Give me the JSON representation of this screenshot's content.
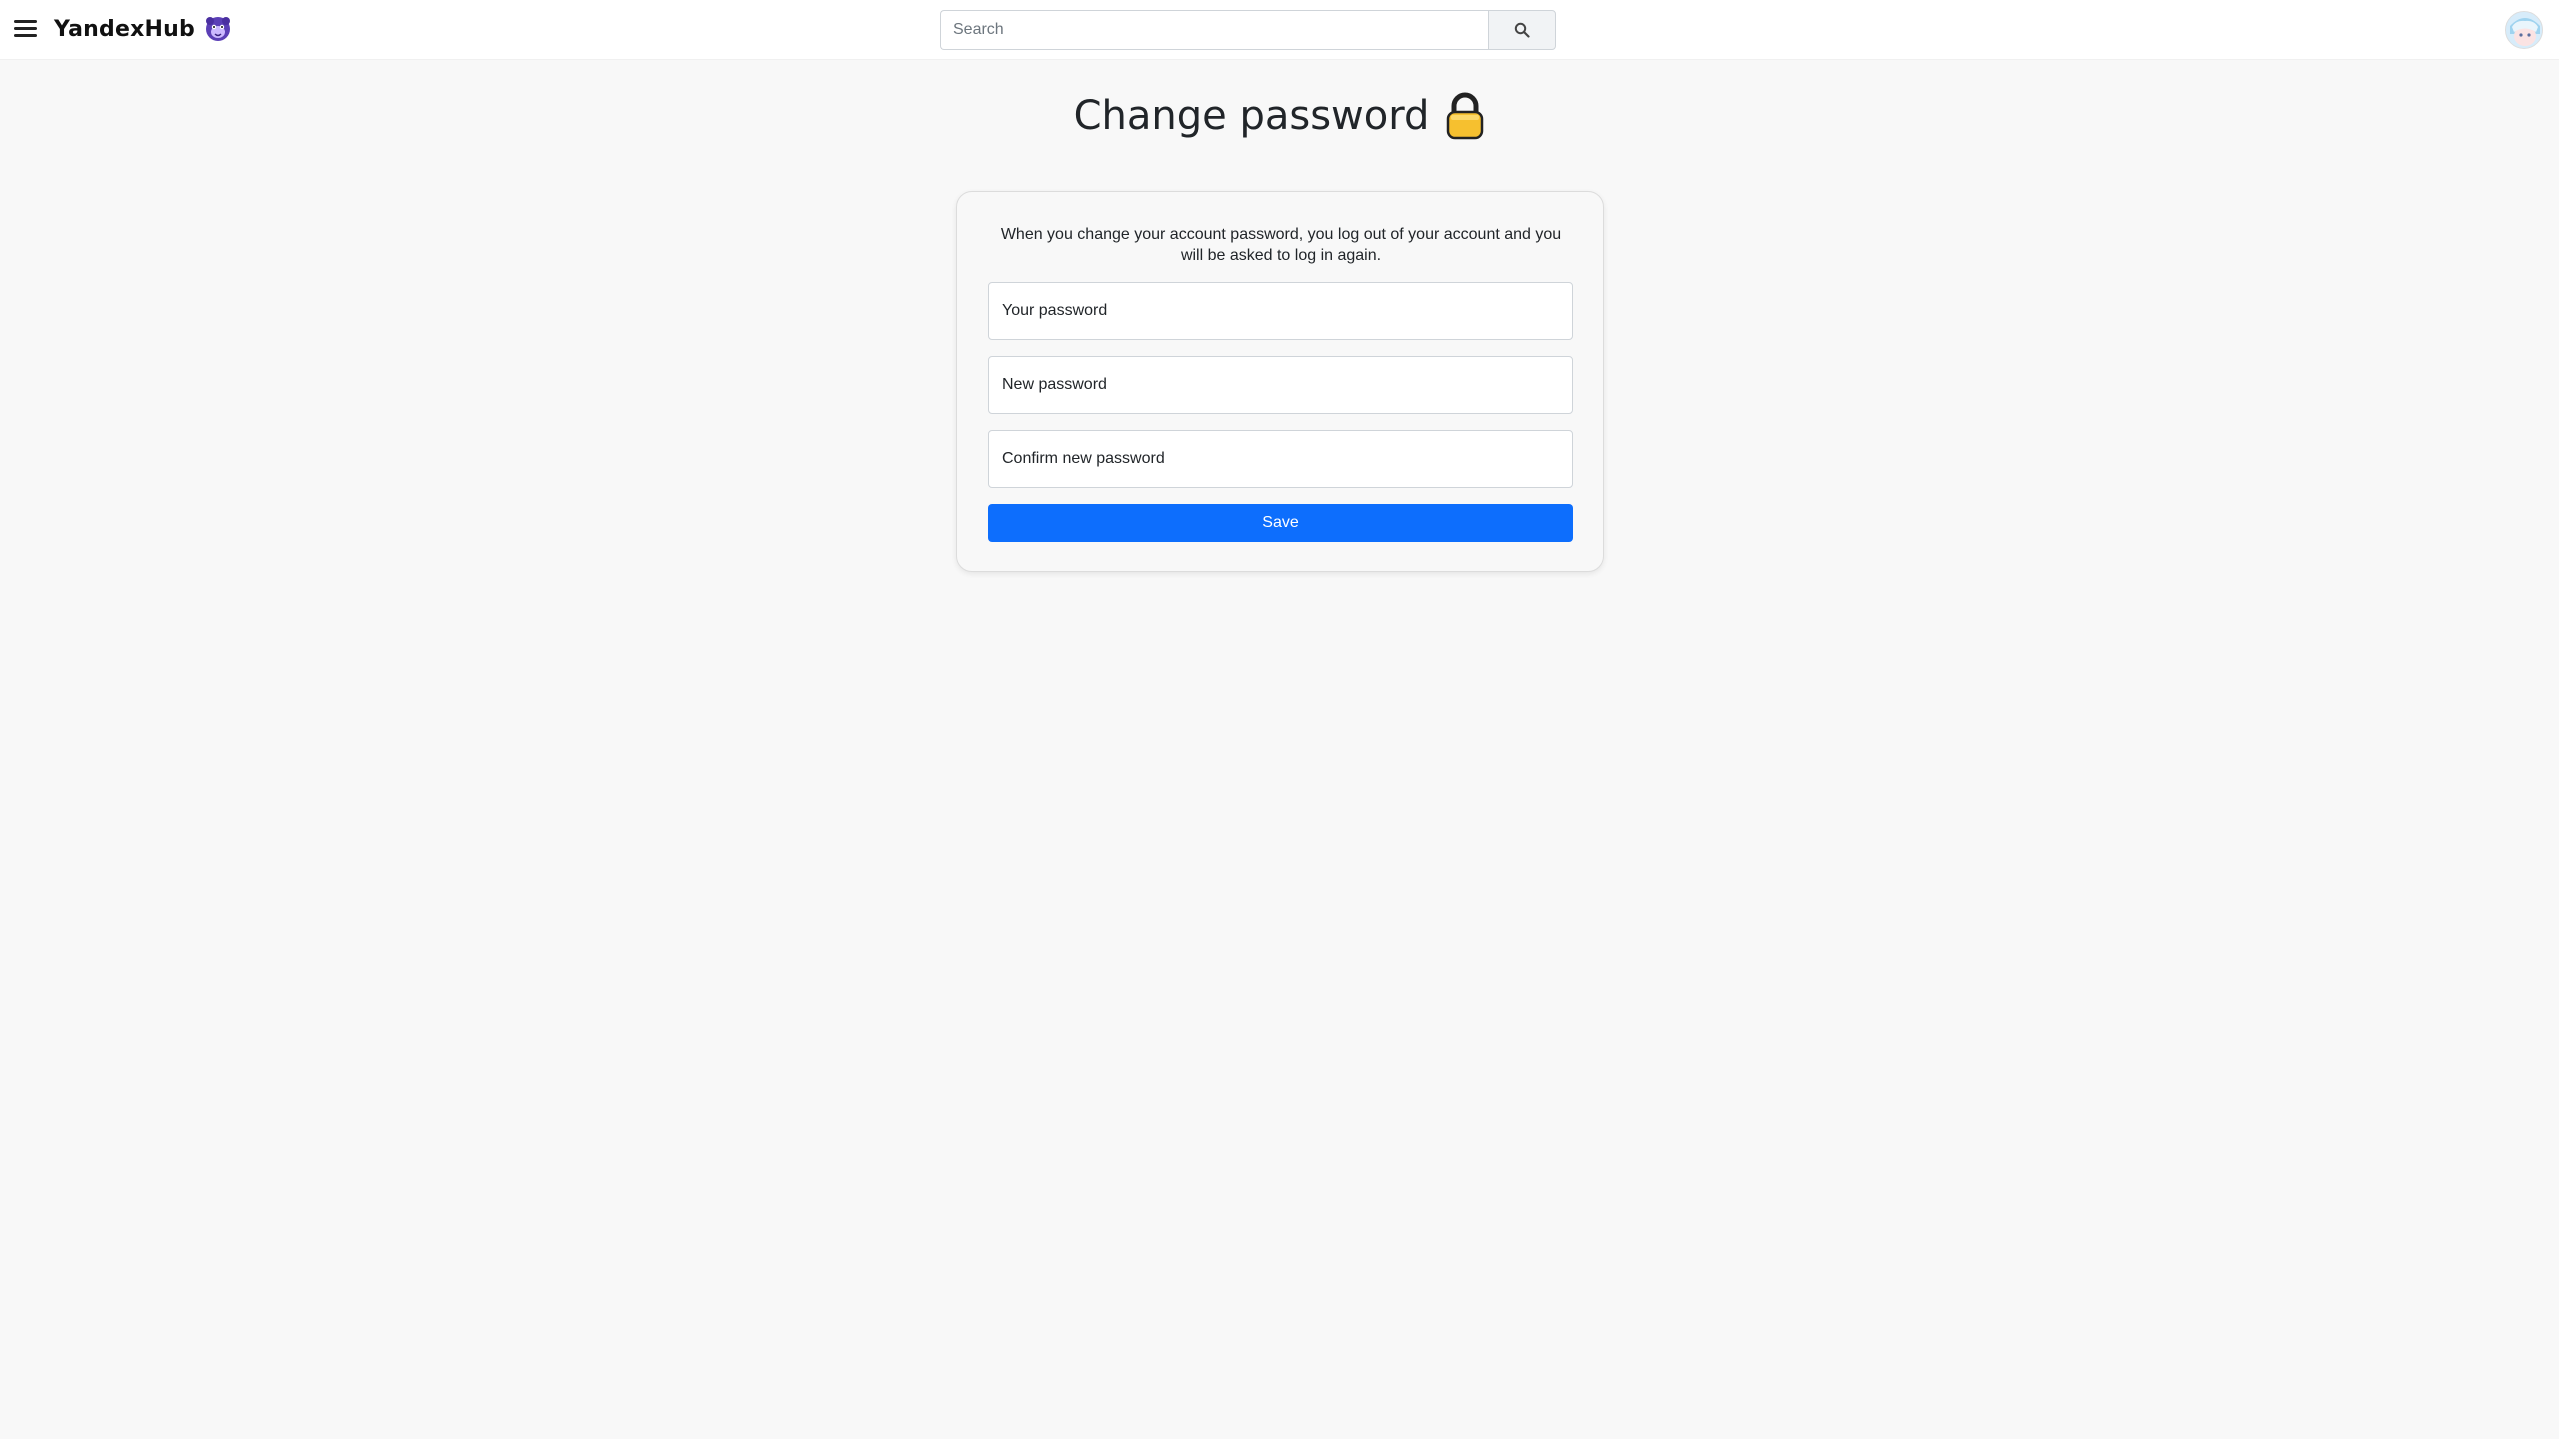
{
  "header": {
    "brand_name": "YandexHub",
    "search": {
      "placeholder": "Search",
      "value": ""
    },
    "icons": {
      "menu": "hamburger-menu-icon",
      "logo": "purple-mascot-logo-icon",
      "search": "magnifier-search-icon",
      "avatar": "user-avatar"
    }
  },
  "main": {
    "title": "Change password",
    "title_icon": "lock-emoji-icon",
    "description": "When you change your account password, you log out of your account and you will be asked to log in again.",
    "fields": {
      "current_placeholder": "Your password",
      "new_placeholder": "New password",
      "confirm_placeholder": "Confirm new password"
    },
    "save_label": "Save"
  },
  "colors": {
    "page_bg": "#f8f8f8",
    "header_bg": "#ffffff",
    "primary_button": "#0d6efd",
    "lock_body": "#f6c02f",
    "lock_shackle": "#222222"
  }
}
